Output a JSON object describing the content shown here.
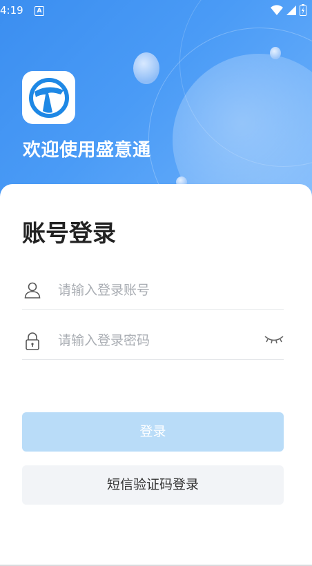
{
  "status_bar": {
    "time": "4:19",
    "a_badge": "A"
  },
  "header": {
    "welcome": "欢迎使用盛意通"
  },
  "login": {
    "title": "账号登录",
    "account_placeholder": "请输入登录账号",
    "password_placeholder": "请输入登录密码",
    "login_button": "登录",
    "sms_button": "短信验证码登录"
  },
  "colors": {
    "brand": "#3b8ef0",
    "login_button_disabled": "#b9dcf8",
    "secondary_button": "#f2f4f7"
  }
}
